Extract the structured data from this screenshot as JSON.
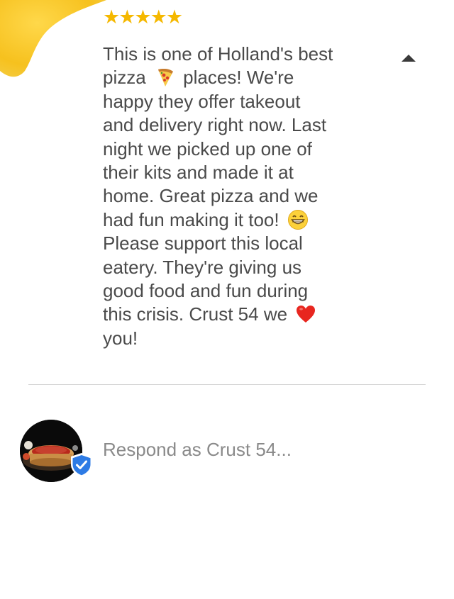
{
  "review": {
    "rating": 5,
    "stars": "★★★★★",
    "lines": [
      "This is one of Holland's best",
      "pizza",
      "places! We're",
      "happy they offer takeout",
      "and delivery right now. Last",
      "night we picked up one of",
      "their kits and made it at",
      "home. Great pizza and we",
      "had fun making it too!",
      "Please support this local",
      "eatery. They're giving us",
      "good food and fun during",
      "this crisis. Crust 54 we",
      "you!"
    ],
    "emojis": [
      "pizza-emoji",
      "grinning-face-emoji",
      "red-heart-emoji"
    ]
  },
  "collapse_icon": "caret-up-icon",
  "response": {
    "placeholder": "Respond as Crust 54...",
    "value": "",
    "avatar_icon": "pizza-avatar",
    "badge_icon": "verified-badge-icon"
  },
  "colors": {
    "star": "#f5b800",
    "text": "#4a4a4a",
    "placeholder": "#8a8a8a",
    "divider": "#d4d4d4",
    "badge": "#2d7be5"
  }
}
